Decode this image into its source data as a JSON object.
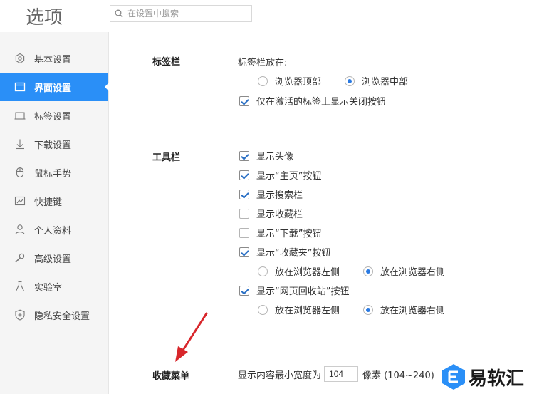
{
  "header": {
    "title": "选项",
    "search_placeholder": "在设置中搜索"
  },
  "sidebar": {
    "items": [
      {
        "label": "基本设置",
        "icon": "gear-icon",
        "active": false
      },
      {
        "label": "界面设置",
        "icon": "window-icon",
        "active": true
      },
      {
        "label": "标签设置",
        "icon": "tab-icon",
        "active": false
      },
      {
        "label": "下载设置",
        "icon": "download-icon",
        "active": false
      },
      {
        "label": "鼠标手势",
        "icon": "mouse-icon",
        "active": false
      },
      {
        "label": "快捷键",
        "icon": "keyboard-icon",
        "active": false
      },
      {
        "label": "个人资料",
        "icon": "user-icon",
        "active": false
      },
      {
        "label": "高级设置",
        "icon": "wrench-icon",
        "active": false
      },
      {
        "label": "实验室",
        "icon": "flask-icon",
        "active": false
      },
      {
        "label": "隐私安全设置",
        "icon": "shield-icon",
        "active": false
      }
    ]
  },
  "tabbar": {
    "label": "标签栏",
    "position_label": "标签栏放在:",
    "pos_top": "浏览器顶部",
    "pos_middle": "浏览器中部",
    "pos_selected": "middle",
    "close_btn_label": "仅在激活的标签上显示关闭按钮",
    "close_btn_checked": true
  },
  "toolbar": {
    "label": "工具栏",
    "show_avatar": "显示头像",
    "show_home": "显示“主页”按钮",
    "show_search": "显示搜索栏",
    "show_favbar": "显示收藏栏",
    "show_download": "显示“下载”按钮",
    "show_favorites": "显示“收藏夹”按钮",
    "fav_left": "放在浏览器左侧",
    "fav_right": "放在浏览器右侧",
    "show_recycle": "显示“网页回收站”按钮",
    "recycle_left": "放在浏览器左侧",
    "recycle_right": "放在浏览器右侧"
  },
  "favmenu": {
    "label": "收藏菜单",
    "width_prefix": "显示内容最小宽度为",
    "width_value": "104",
    "width_suffix": "像素 (104~240)"
  },
  "watermark": {
    "text": "易软汇"
  },
  "colors": {
    "accent": "#2a8ff7",
    "annotation": "#d8262b"
  }
}
